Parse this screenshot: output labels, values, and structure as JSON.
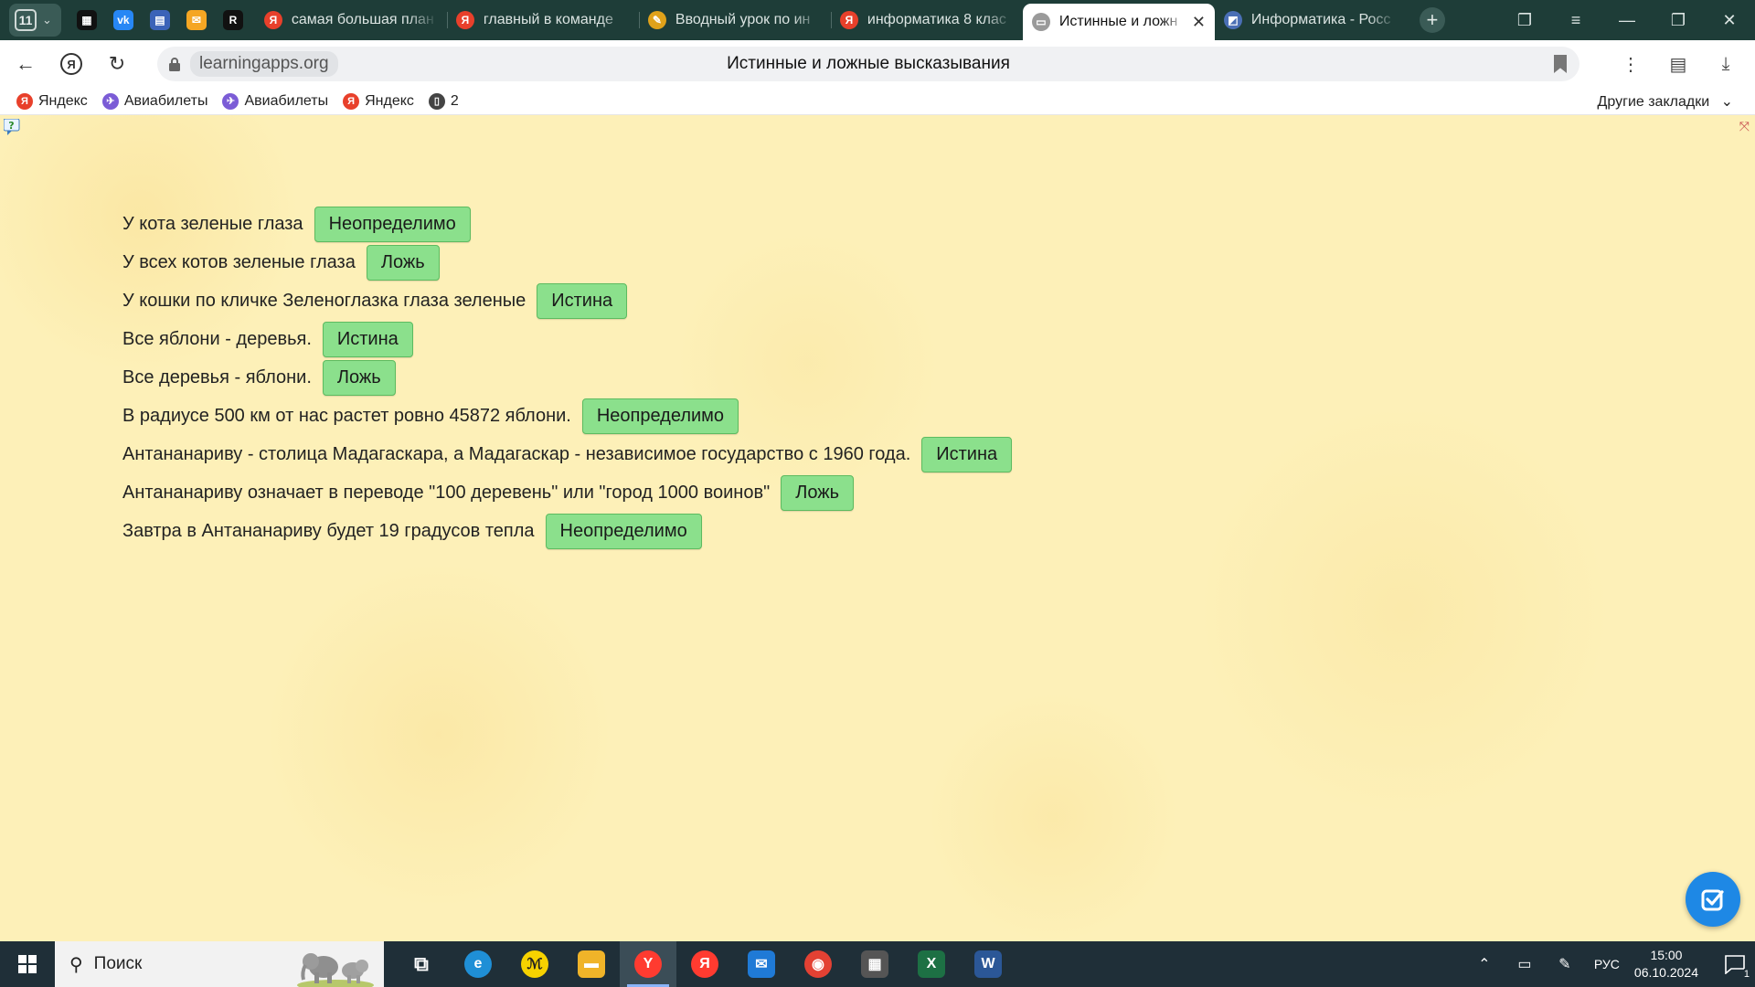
{
  "browser": {
    "tab_count": "11",
    "pinned": [
      {
        "name": "pinned-app-icon",
        "glyph": "▦",
        "color": "#111111"
      },
      {
        "name": "vk-icon",
        "glyph": "vk",
        "color": "#2787f5"
      },
      {
        "name": "calendar-icon",
        "glyph": "▤",
        "color": "#3b63b8"
      },
      {
        "name": "mail-icon",
        "glyph": "✉",
        "color": "#f5a623"
      },
      {
        "name": "r-app-icon",
        "glyph": "R",
        "color": "#111111"
      }
    ],
    "tabs": [
      {
        "title": "самая большая план",
        "favicon": "Я",
        "color": "#e8402b",
        "active": false
      },
      {
        "title": "главный в команде",
        "favicon": "Я",
        "color": "#e8402b",
        "active": false
      },
      {
        "title": "Вводный урок по ин",
        "favicon": "✎",
        "color": "#e0a21a",
        "active": false
      },
      {
        "title": "информатика 8 клас",
        "favicon": "Я",
        "color": "#e8402b",
        "active": false
      },
      {
        "title": "Истинные и ложн",
        "favicon": "▭",
        "color": "#9a9a9a",
        "active": true
      },
      {
        "title": "Информатика - Росс",
        "favicon": "◩",
        "color": "#4a6fb5",
        "active": false
      }
    ],
    "address": {
      "domain": "learningapps.org",
      "page_title": "Истинные и ложные высказывания"
    },
    "bookmarks": [
      {
        "label": "Яндекс",
        "icon": "Я",
        "color": "#e8402b"
      },
      {
        "label": "Авиабилеты",
        "icon": "✈",
        "color": "#7b5cd6"
      },
      {
        "label": "Авиабилеты",
        "icon": "✈",
        "color": "#7b5cd6"
      },
      {
        "label": "Яндекс",
        "icon": "Я",
        "color": "#e8402b"
      },
      {
        "label": "2",
        "icon": "▯",
        "color": "#444444"
      }
    ],
    "other_bookmarks": "Другие закладки"
  },
  "quiz": {
    "rows": [
      {
        "statement": "У кота зеленые глаза",
        "answer": "Неопределимо"
      },
      {
        "statement": "У всех котов зеленые глаза",
        "answer": "Ложь"
      },
      {
        "statement": "У кошки по кличке Зеленоглазка глаза зеленые",
        "answer": "Истина"
      },
      {
        "statement": "Все яблони - деревья.",
        "answer": "Истина"
      },
      {
        "statement": "Все деревья - яблони.",
        "answer": "Ложь"
      },
      {
        "statement": "В радиусе 500 км от нас растет ровно 45872 яблони.",
        "answer": "Неопределимо"
      },
      {
        "statement": "Антананариву - столица Мадагаскара, а Мадагаскар - независимое государство с 1960 года.",
        "answer": "Истина"
      },
      {
        "statement": "Антананариву означает в переводе \"100 деревень\" или \"город 1000 воинов\"",
        "answer": "Ложь"
      },
      {
        "statement": "Завтра в Антананариву будет 19 градусов тепла",
        "answer": "Неопределимо"
      }
    ],
    "chip_color": "#8be08c"
  },
  "taskbar": {
    "search_placeholder": "Поиск",
    "apps": [
      {
        "name": "task-view-icon",
        "glyph": "⧉",
        "color": "transparent",
        "active": false
      },
      {
        "name": "edge-icon",
        "glyph": "e",
        "color": "#1f8fd6",
        "active": false
      },
      {
        "name": "yandex-market-icon",
        "glyph": "ℳ",
        "color": "#f6d200",
        "active": false
      },
      {
        "name": "file-explorer-icon",
        "glyph": "▬",
        "color": "#f0b429",
        "active": false
      },
      {
        "name": "yandex-browser-icon",
        "glyph": "Y",
        "color": "#ff3b30",
        "active": true
      },
      {
        "name": "yandex-icon",
        "glyph": "Я",
        "color": "#ff3b30",
        "active": false
      },
      {
        "name": "mail-app-icon",
        "glyph": "✉",
        "color": "#1f7ad6",
        "active": false
      },
      {
        "name": "chrome-icon",
        "glyph": "◉",
        "color": "#e34133",
        "active": false
      },
      {
        "name": "store-icon",
        "glyph": "▦",
        "color": "#555555",
        "active": false
      },
      {
        "name": "excel-icon",
        "glyph": "X",
        "color": "#1d7044",
        "active": false
      },
      {
        "name": "word-icon",
        "glyph": "W",
        "color": "#2b5797",
        "active": false
      }
    ],
    "language": "РУС",
    "time": "15:00",
    "date": "06.10.2024",
    "notifications": "1"
  }
}
